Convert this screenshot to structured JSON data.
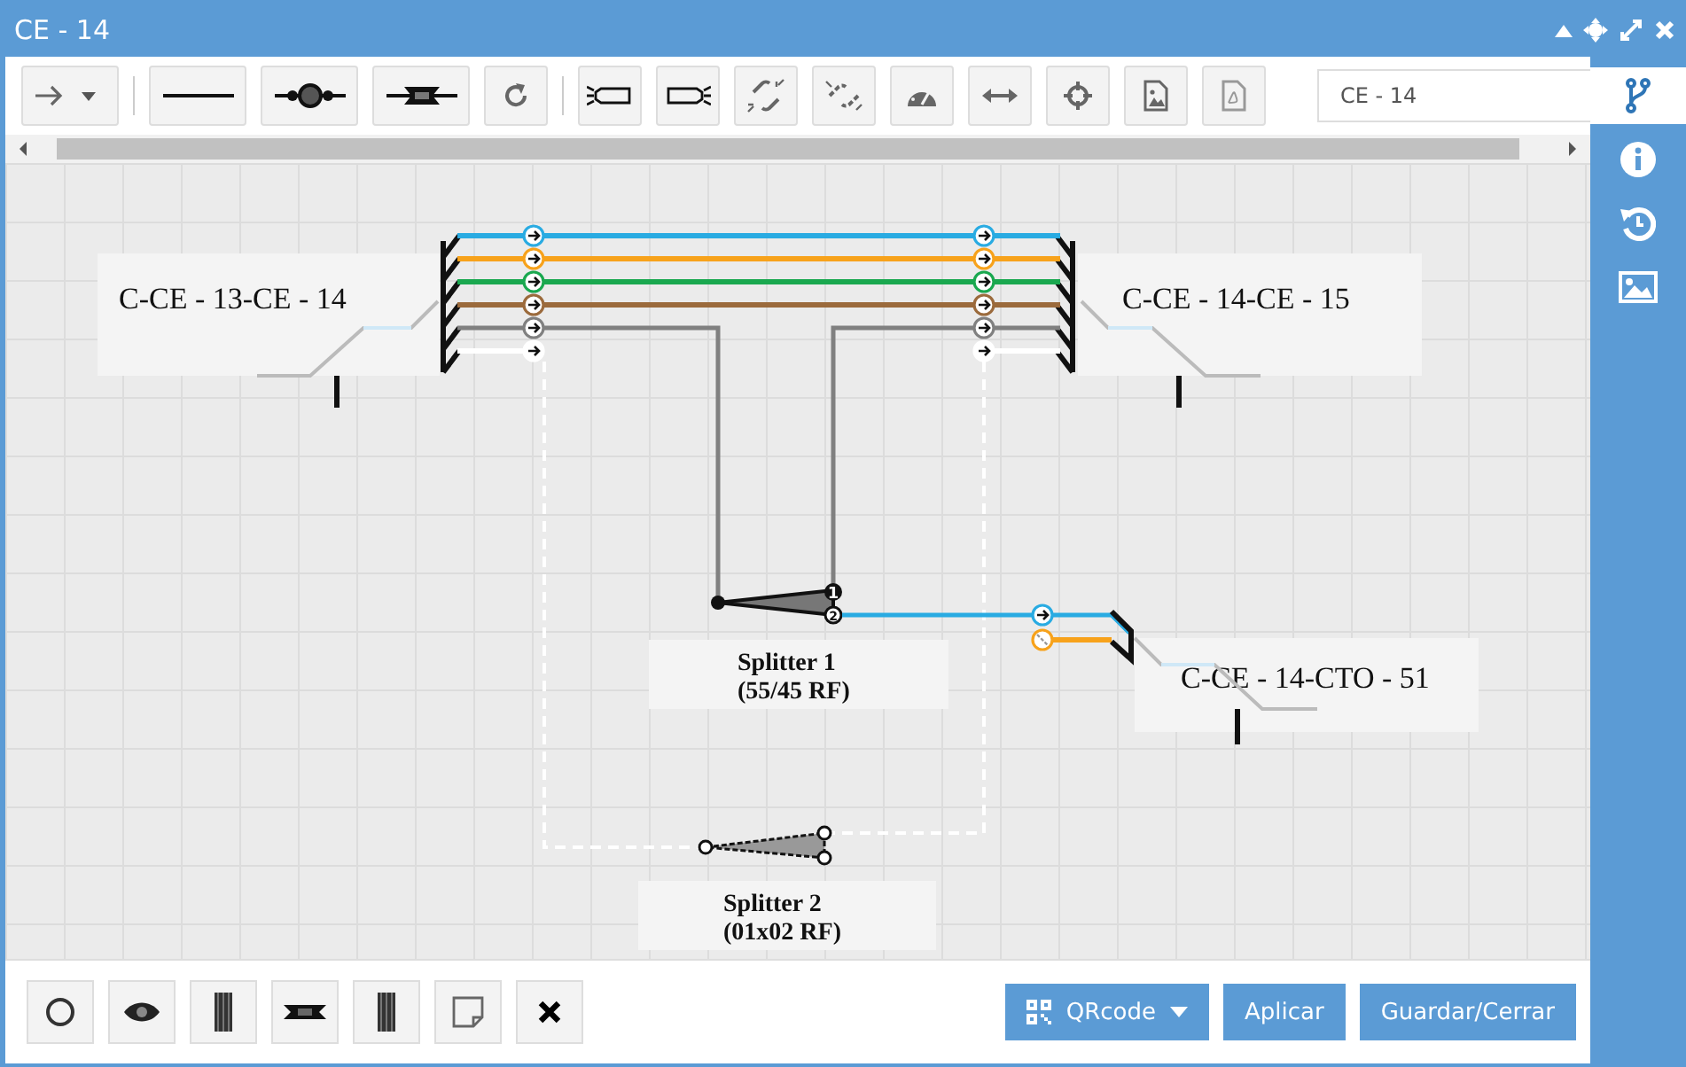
{
  "window": {
    "title": "CE - 14"
  },
  "toolbar": [
    {
      "kind": "arrow-menu"
    },
    {
      "kind": "line"
    },
    {
      "kind": "splice-round"
    },
    {
      "kind": "splice-box"
    },
    {
      "kind": "redo"
    },
    {
      "kind": "light-in"
    },
    {
      "kind": "light-out"
    },
    {
      "kind": "unlink"
    },
    {
      "kind": "link"
    },
    {
      "kind": "gauge"
    },
    {
      "kind": "width"
    },
    {
      "kind": "move"
    },
    {
      "kind": "image"
    },
    {
      "kind": "pdf"
    }
  ],
  "search": {
    "value": "CE - 14"
  },
  "sidebar": [
    {
      "kind": "branch",
      "selected": true
    },
    {
      "kind": "info",
      "selected": false
    },
    {
      "kind": "history",
      "selected": false
    },
    {
      "kind": "image",
      "selected": false
    }
  ],
  "cables": [
    {
      "label": "C-CE - 13-CE - 14"
    },
    {
      "label": "C-CE - 14-CE - 15"
    },
    {
      "label": "C-CE - 14-CTO - 51"
    }
  ],
  "fibers": [
    {
      "color": "#29abe2"
    },
    {
      "color": "#f7a21b"
    },
    {
      "color": "#1aa84f"
    },
    {
      "color": "#9b6a3c"
    },
    {
      "color": "#808080"
    },
    {
      "color": "#ffffff"
    }
  ],
  "cto_fibers": [
    {
      "color": "#29abe2"
    },
    {
      "color": "#f7a21b"
    }
  ],
  "splitters": [
    {
      "name": "Splitter 1",
      "ratio": "(55/45 RF)",
      "ports": [
        "1",
        "2"
      ]
    },
    {
      "name": "Splitter 2",
      "ratio": "(01x02 RF)"
    }
  ],
  "bottom_tools": [
    {
      "kind": "circle"
    },
    {
      "kind": "eye"
    },
    {
      "kind": "strip"
    },
    {
      "kind": "connector"
    },
    {
      "kind": "strip"
    },
    {
      "kind": "note"
    },
    {
      "kind": "close"
    }
  ],
  "actions": [
    {
      "label": "QRcode",
      "kind": "menu"
    },
    {
      "label": "Aplicar",
      "kind": "plain"
    },
    {
      "label": "Guardar/Cerrar",
      "kind": "plain"
    }
  ]
}
